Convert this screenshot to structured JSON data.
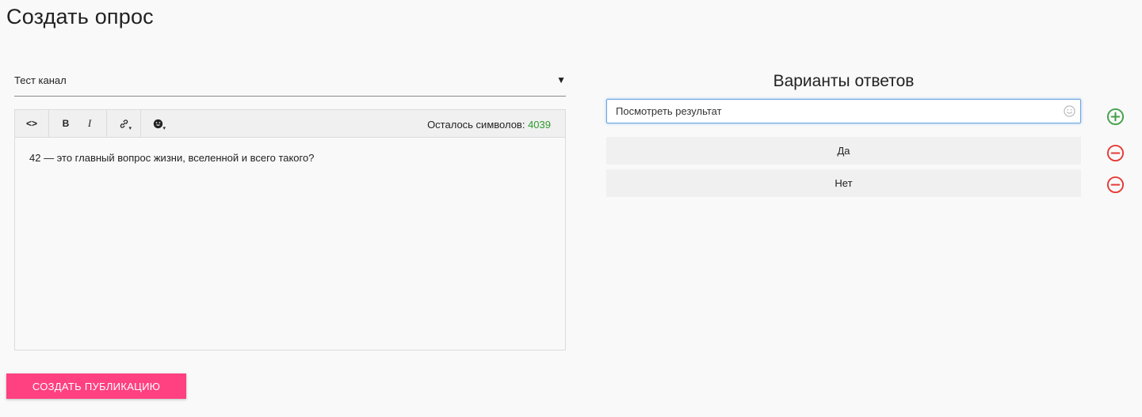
{
  "page": {
    "title": "Создать опрос"
  },
  "channel_select": {
    "value": "Тест канал",
    "arrow": "▼"
  },
  "toolbar": {
    "code_label": "<>",
    "bold_label": "B",
    "italic_label": "I",
    "counter_label": "Осталось символов:",
    "counter_value": "4039"
  },
  "editor": {
    "text": "42 — это главный вопрос жизни, вселенной и всего такого?"
  },
  "publish_button": {
    "label": "СОЗДАТЬ ПУБЛИКАЦИЮ"
  },
  "answers": {
    "title": "Варианты ответов",
    "input_value": "Посмотреть результат",
    "items": [
      {
        "label": "Да"
      },
      {
        "label": "Нет"
      }
    ]
  },
  "colors": {
    "accent": "#ff4081",
    "add": "#43a047",
    "remove": "#e53935",
    "counter": "#2e9a2e",
    "focus_border": "#6aa6e0"
  },
  "icons": {
    "add": "plus-circle-icon",
    "remove": "minus-circle-icon",
    "emoji": "smiley-icon",
    "link": "link-icon",
    "code": "code-icon"
  }
}
